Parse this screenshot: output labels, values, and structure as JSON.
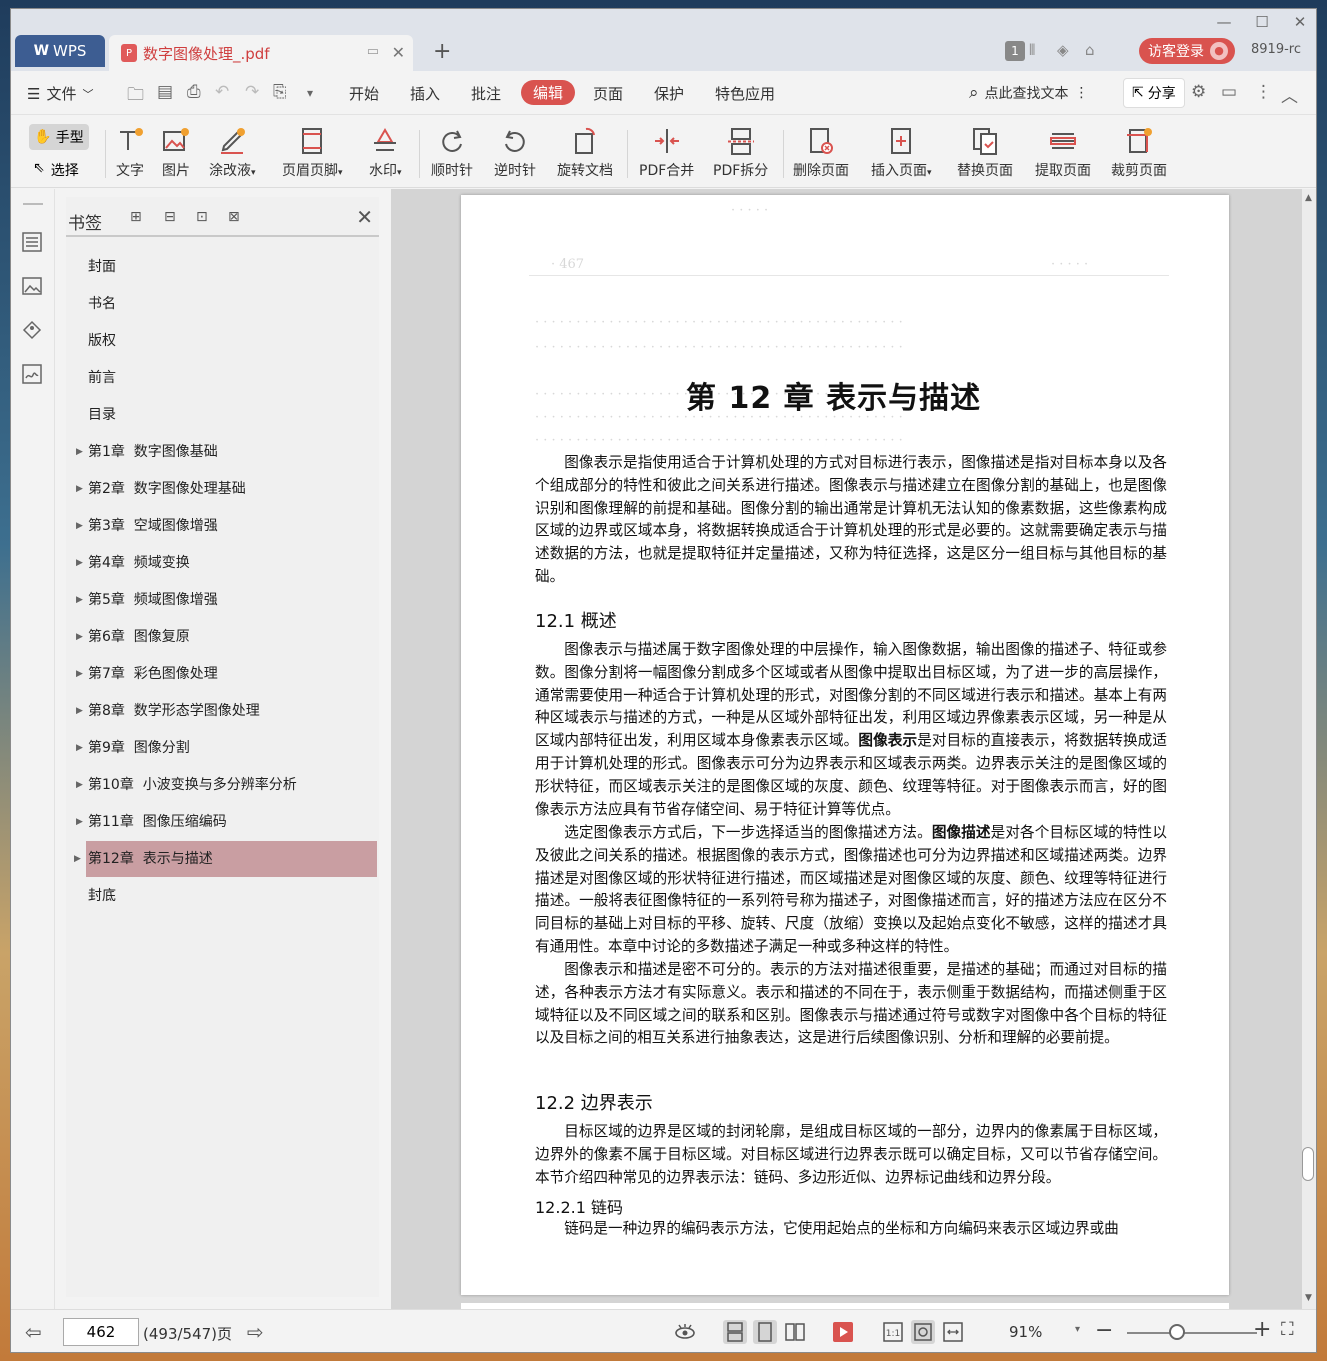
{
  "titlebar": {
    "app_tab": "WPS",
    "app_logo": "W",
    "doc_tab": "数字图像处理_.pdf",
    "doc_badge": "1",
    "visitor_login": "访客登录",
    "user_code": "8919-rc"
  },
  "menubar": {
    "file": "文件",
    "tabs": [
      "开始",
      "插入",
      "批注",
      "编辑",
      "页面",
      "保护",
      "特色应用"
    ],
    "active_tab": "编辑",
    "search": "点此查找文本",
    "share": "分享"
  },
  "toolbar": {
    "hand": "手型",
    "select": "选择",
    "tools": [
      "文字",
      "图片",
      "涂改液",
      "页眉页脚",
      "水印",
      "顺时针",
      "逆时针",
      "旋转文档",
      "PDF合并",
      "PDF拆分",
      "删除页面",
      "插入页面",
      "替换页面",
      "提取页面",
      "裁剪页面"
    ]
  },
  "bookmarks": {
    "title": "书签",
    "items": [
      {
        "label": "封面",
        "expandable": false
      },
      {
        "label": "书名",
        "expandable": false
      },
      {
        "label": "版权",
        "expandable": false
      },
      {
        "label": "前言",
        "expandable": false
      },
      {
        "label": "目录",
        "expandable": false
      },
      {
        "label": "第1章  数字图像基础",
        "expandable": true
      },
      {
        "label": "第2章  数字图像处理基础",
        "expandable": true
      },
      {
        "label": "第3章  空域图像增强",
        "expandable": true
      },
      {
        "label": "第4章  频域变换",
        "expandable": true
      },
      {
        "label": "第5章  频域图像增强",
        "expandable": true
      },
      {
        "label": "第6章  图像复原",
        "expandable": true
      },
      {
        "label": "第7章  彩色图像处理",
        "expandable": true
      },
      {
        "label": "第8章  数学形态学图像处理",
        "expandable": true
      },
      {
        "label": "第9章  图像分割",
        "expandable": true
      },
      {
        "label": "第10章  小波变换与多分辨率分析",
        "expandable": true
      },
      {
        "label": "第11章  图像压缩编码",
        "expandable": true
      },
      {
        "label": "第12章  表示与描述",
        "expandable": true
      },
      {
        "label": "封底",
        "expandable": false
      }
    ],
    "selected": "第12章  表示与描述",
    "selected_color": "#c99ea2"
  },
  "document": {
    "chapter_title": "第 12 章    表示与描述",
    "intro": "图像表示是指使用适合于计算机处理的方式对目标进行表示，图像描述是指对目标本身以及各个组成部分的特性和彼此之间关系进行描述。图像表示与描述建立在图像分割的基础上，也是图像识别和图像理解的前提和基础。图像分割的输出通常是计算机无法认知的像素数据，这些像素构成区域的边界或区域本身，将数据转换成适合于计算机处理的形式是必要的。这就需要确定表示与描述数据的方法，也就是提取特征并定量描述，又称为特征选择，这是区分一组目标与其他目标的基础。",
    "sec1_title": "12.1    概述",
    "sec1_p1_a": "图像表示与描述属于数字图像处理的中层操作，输入图像数据，输出图像的描述子、特征或参数。图像分割将一幅图像分割成多个区域或者从图像中提取出目标区域，为了进一步的高层操作，通常需要使用一种适合于计算机处理的形式，对图像分割的不同区域进行表示和描述。基本上有两种区域表示与描述的方式，一种是从区域外部特征出发，利用区域边界像素表示区域，另一种是从区域内部特征出发，利用区域本身像素表示区域。",
    "sec1_p1_bold": "图像表示",
    "sec1_p1_b": "是对目标的直接表示，将数据转换成适用于计算机处理的形式。图像表示可分为边界表示和区域表示两类。边界表示关注的是图像区域的形状特征，而区域表示关注的是图像区域的灰度、颜色、纹理等特征。对于图像表示而言，好的图像表示方法应具有节省存储空间、易于特征计算等优点。",
    "sec1_p2_a": "选定图像表示方式后，下一步选择适当的图像描述方法。",
    "sec1_p2_bold": "图像描述",
    "sec1_p2_b": "是对各个目标区域的特性以及彼此之间关系的描述。根据图像的表示方式，图像描述也可分为边界描述和区域描述两类。边界描述是对图像区域的形状特征进行描述，而区域描述是对图像区域的灰度、颜色、纹理等特征进行描述。一般将表征图像特征的一系列符号称为描述子，对图像描述而言，好的描述方法应在区分不同目标的基础上对目标的平移、旋转、尺度（放缩）变换以及起始点变化不敏感，这样的描述才具有通用性。本章中讨论的多数描述子满足一种或多种这样的特性。",
    "sec1_p3": "图像表示和描述是密不可分的。表示的方法对描述很重要，是描述的基础；而通过对目标的描述，各种表示方法才有实际意义。表示和描述的不同在于，表示侧重于数据结构，而描述侧重于区域特征以及不同区域之间的联系和区别。图像表示与描述通过符号或数字对图像中各个目标的特征以及目标之间的相互关系进行抽象表达，这是进行后续图像识别、分析和理解的必要前提。",
    "sec2_title": "12.2    边界表示",
    "sec2_p1": "目标区域的边界是区域的封闭轮廓，是组成目标区域的一部分，边界内的像素属于目标区域，边界外的像素不属于目标区域。对目标区域进行边界表示既可以确定目标，又可以节省存储空间。本节介绍四种常见的边界表示法：链码、多边形近似、边界标记曲线和边界分段。",
    "sub_title": "12.2.1    链码",
    "sub_p1": "链码是一种边界的编码表示方法，它使用起始点的坐标和方向编码来表示区域边界或曲"
  },
  "statusbar": {
    "page_number": "462",
    "page_total": "(493/547)页",
    "zoom": "91%"
  }
}
